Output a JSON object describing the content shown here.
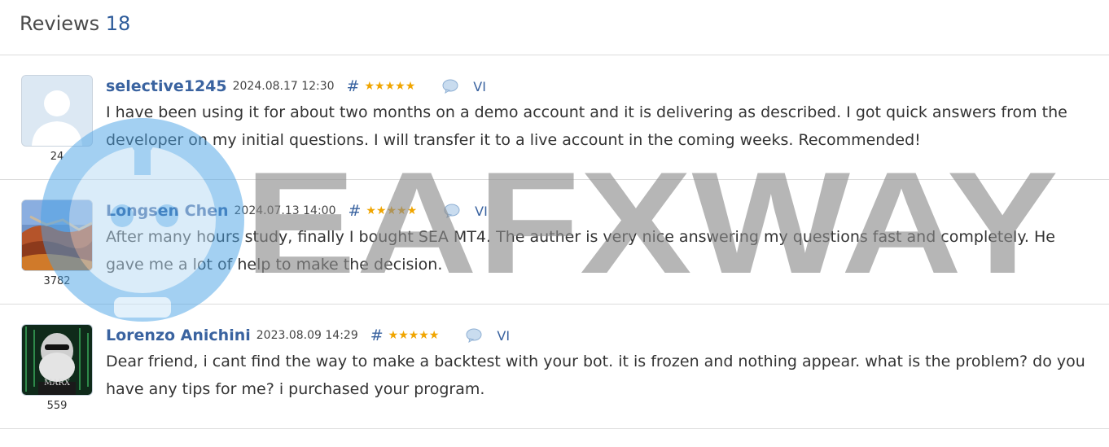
{
  "header": {
    "title": "Reviews",
    "count": "18"
  },
  "reviews": [
    {
      "author": "selective1245",
      "date": "2024.08.17 12:30",
      "hash": "#",
      "stars": "★★★★★",
      "lang": "VI",
      "rating_count": "24",
      "avatar": "default-user-avatar",
      "text": "I have been using it for about two months on a demo account and it is delivering as described. I got quick answers from the developer on my initial questions. I will transfer it to a live account in the coming weeks. Recommended!"
    },
    {
      "author": "Longsen Chen",
      "date": "2024.07.13 14:00",
      "hash": "#",
      "stars": "★★★★★",
      "lang": "VI",
      "rating_count": "3782",
      "avatar": "great-wall-photo",
      "text": "After many hours study, finally I bought SEA MT4. The auther is very nice answering my questions fast and completely. He gave me a lot of help to make the decision."
    },
    {
      "author": "Lorenzo Anichini",
      "date": "2023.08.09 14:29",
      "hash": "#",
      "stars": "★★★★★",
      "lang": "VI",
      "rating_count": "559",
      "avatar": "marx-reloaded-photo",
      "text": "Dear friend, i cant find the way to make a backtest with your bot. it is frozen and nothing appear. what is the problem? do you have any tips for me? i purchased your program."
    }
  ],
  "watermark": {
    "text": "EAFXWAY",
    "icon": "robot-logo-icon"
  },
  "colors": {
    "accent": "#3a63a0",
    "star": "#f0a500",
    "divider": "#dcdcdc"
  }
}
